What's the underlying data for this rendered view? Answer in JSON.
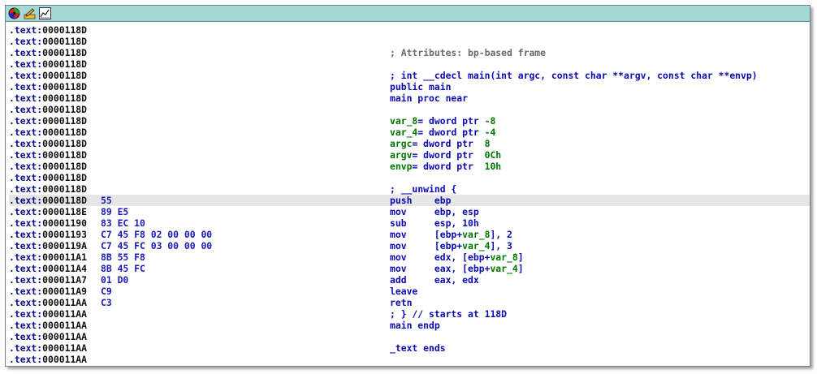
{
  "window": {
    "toolbar": [
      {
        "name": "graph-overview-icon"
      },
      {
        "name": "edit-pencil-icon"
      },
      {
        "name": "chart-icon"
      }
    ]
  },
  "listing": [
    {
      "seg": ".text",
      "off": "0000118D",
      "bytes": "",
      "parts": []
    },
    {
      "seg": ".text",
      "off": "0000118D",
      "bytes": "",
      "parts": []
    },
    {
      "seg": ".text",
      "off": "0000118D",
      "bytes": "",
      "parts": [
        {
          "t": "; Attributes: bp-based frame",
          "c": "comment"
        }
      ]
    },
    {
      "seg": ".text",
      "off": "0000118D",
      "bytes": "",
      "parts": []
    },
    {
      "seg": ".text",
      "off": "0000118D",
      "bytes": "",
      "parts": [
        {
          "t": "; int __cdecl main(int argc, const char **argv, const char **envp)",
          "c": "blue"
        }
      ]
    },
    {
      "seg": ".text",
      "off": "0000118D",
      "bytes": "",
      "parts": [
        {
          "t": "public main",
          "c": "blue"
        }
      ]
    },
    {
      "seg": ".text",
      "off": "0000118D",
      "bytes": "",
      "parts": [
        {
          "t": "main proc near",
          "c": "blue"
        }
      ]
    },
    {
      "seg": ".text",
      "off": "0000118D",
      "bytes": "",
      "parts": []
    },
    {
      "seg": ".text",
      "off": "0000118D",
      "bytes": "",
      "parts": [
        {
          "t": "var_8",
          "c": "green"
        },
        {
          "t": "= dword ptr ",
          "c": "blue"
        },
        {
          "t": "-8",
          "c": "green"
        }
      ]
    },
    {
      "seg": ".text",
      "off": "0000118D",
      "bytes": "",
      "parts": [
        {
          "t": "var_4",
          "c": "green"
        },
        {
          "t": "= dword ptr ",
          "c": "blue"
        },
        {
          "t": "-4",
          "c": "green"
        }
      ]
    },
    {
      "seg": ".text",
      "off": "0000118D",
      "bytes": "",
      "parts": [
        {
          "t": "argc",
          "c": "green"
        },
        {
          "t": "= dword ptr  ",
          "c": "blue"
        },
        {
          "t": "8",
          "c": "green"
        }
      ]
    },
    {
      "seg": ".text",
      "off": "0000118D",
      "bytes": "",
      "parts": [
        {
          "t": "argv",
          "c": "green"
        },
        {
          "t": "= dword ptr  ",
          "c": "blue"
        },
        {
          "t": "0Ch",
          "c": "green"
        }
      ]
    },
    {
      "seg": ".text",
      "off": "0000118D",
      "bytes": "",
      "parts": [
        {
          "t": "envp",
          "c": "green"
        },
        {
          "t": "= dword ptr  ",
          "c": "blue"
        },
        {
          "t": "10h",
          "c": "green"
        }
      ]
    },
    {
      "seg": ".text",
      "off": "0000118D",
      "bytes": "",
      "parts": []
    },
    {
      "seg": ".text",
      "off": "0000118D",
      "bytes": "",
      "parts": [
        {
          "t": "; __unwind {",
          "c": "blue"
        }
      ]
    },
    {
      "seg": ".text",
      "off": "0000118D",
      "bytes": "55",
      "selected": true,
      "parts": [
        {
          "t": "push    ebp",
          "c": "blue"
        }
      ]
    },
    {
      "seg": ".text",
      "off": "0000118E",
      "bytes": "89 E5",
      "parts": [
        {
          "t": "mov     ebp, esp",
          "c": "blue"
        }
      ]
    },
    {
      "seg": ".text",
      "off": "00001190",
      "bytes": "83 EC 10",
      "parts": [
        {
          "t": "sub     esp, 10h",
          "c": "blue"
        }
      ]
    },
    {
      "seg": ".text",
      "off": "00001193",
      "bytes": "C7 45 F8 02 00 00 00",
      "parts": [
        {
          "t": "mov     [ebp+",
          "c": "blue"
        },
        {
          "t": "var_8",
          "c": "green"
        },
        {
          "t": "], 2",
          "c": "blue"
        }
      ]
    },
    {
      "seg": ".text",
      "off": "0000119A",
      "bytes": "C7 45 FC 03 00 00 00",
      "parts": [
        {
          "t": "mov     [ebp+",
          "c": "blue"
        },
        {
          "t": "var_4",
          "c": "green"
        },
        {
          "t": "], 3",
          "c": "blue"
        }
      ]
    },
    {
      "seg": ".text",
      "off": "000011A1",
      "bytes": "8B 55 F8",
      "parts": [
        {
          "t": "mov     edx, [ebp+",
          "c": "blue"
        },
        {
          "t": "var_8",
          "c": "green"
        },
        {
          "t": "]",
          "c": "blue"
        }
      ]
    },
    {
      "seg": ".text",
      "off": "000011A4",
      "bytes": "8B 45 FC",
      "parts": [
        {
          "t": "mov     eax, [ebp+",
          "c": "blue"
        },
        {
          "t": "var_4",
          "c": "green"
        },
        {
          "t": "]",
          "c": "blue"
        }
      ]
    },
    {
      "seg": ".text",
      "off": "000011A7",
      "bytes": "01 D0",
      "parts": [
        {
          "t": "add     eax, edx",
          "c": "blue"
        }
      ]
    },
    {
      "seg": ".text",
      "off": "000011A9",
      "bytes": "C9",
      "parts": [
        {
          "t": "leave",
          "c": "blue"
        }
      ]
    },
    {
      "seg": ".text",
      "off": "000011AA",
      "bytes": "C3",
      "parts": [
        {
          "t": "retn",
          "c": "blue"
        }
      ]
    },
    {
      "seg": ".text",
      "off": "000011AA",
      "bytes": "",
      "parts": [
        {
          "t": "; } // starts at 118D",
          "c": "blue"
        }
      ]
    },
    {
      "seg": ".text",
      "off": "000011AA",
      "bytes": "",
      "parts": [
        {
          "t": "main endp",
          "c": "blue"
        }
      ]
    },
    {
      "seg": ".text",
      "off": "000011AA",
      "bytes": "",
      "parts": []
    },
    {
      "seg": ".text",
      "off": "000011AA",
      "bytes": "",
      "parts": [
        {
          "t": "_text ends",
          "c": "blue"
        }
      ]
    },
    {
      "seg": ".text",
      "off": "000011AA",
      "bytes": "",
      "parts": []
    }
  ]
}
